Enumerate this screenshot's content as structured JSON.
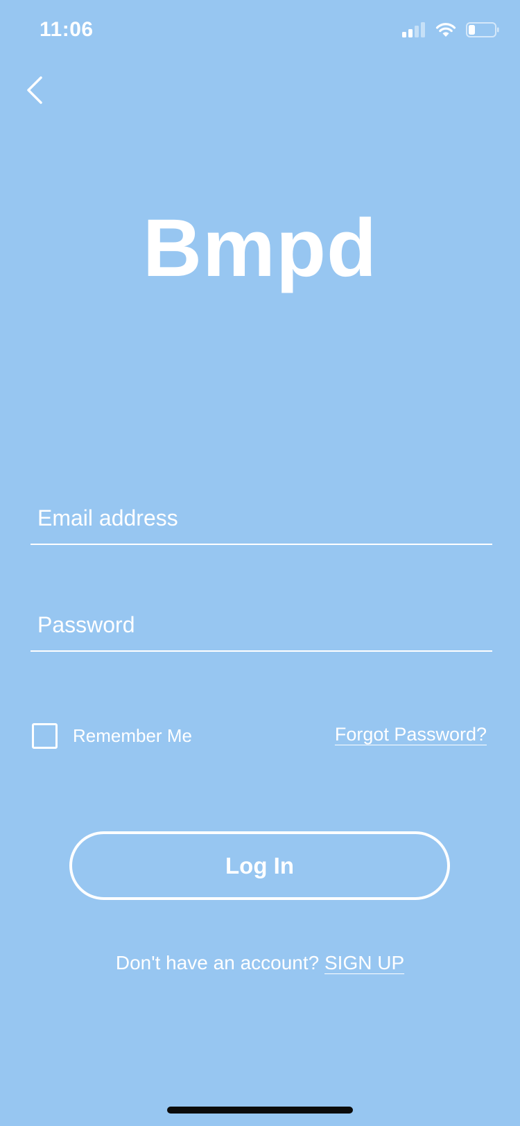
{
  "status_bar": {
    "time": "11:06",
    "icons": [
      "cellular-signal-icon",
      "wifi-icon",
      "battery-icon"
    ]
  },
  "nav": {
    "back_icon": "chevron-left-icon"
  },
  "logo": {
    "text": "Bmpd"
  },
  "form": {
    "email_placeholder": "Email address",
    "email_value": "",
    "password_placeholder": "Password",
    "password_value": "",
    "remember_label": "Remember Me",
    "remember_checked": false,
    "forgot_label": "Forgot Password?",
    "login_label": "Log In"
  },
  "signup": {
    "prompt": "Don't have an account? ",
    "link_label": "SIGN UP"
  },
  "colors": {
    "background": "#97c6f1",
    "foreground": "#ffffff",
    "home_indicator": "#0b0b0b"
  }
}
